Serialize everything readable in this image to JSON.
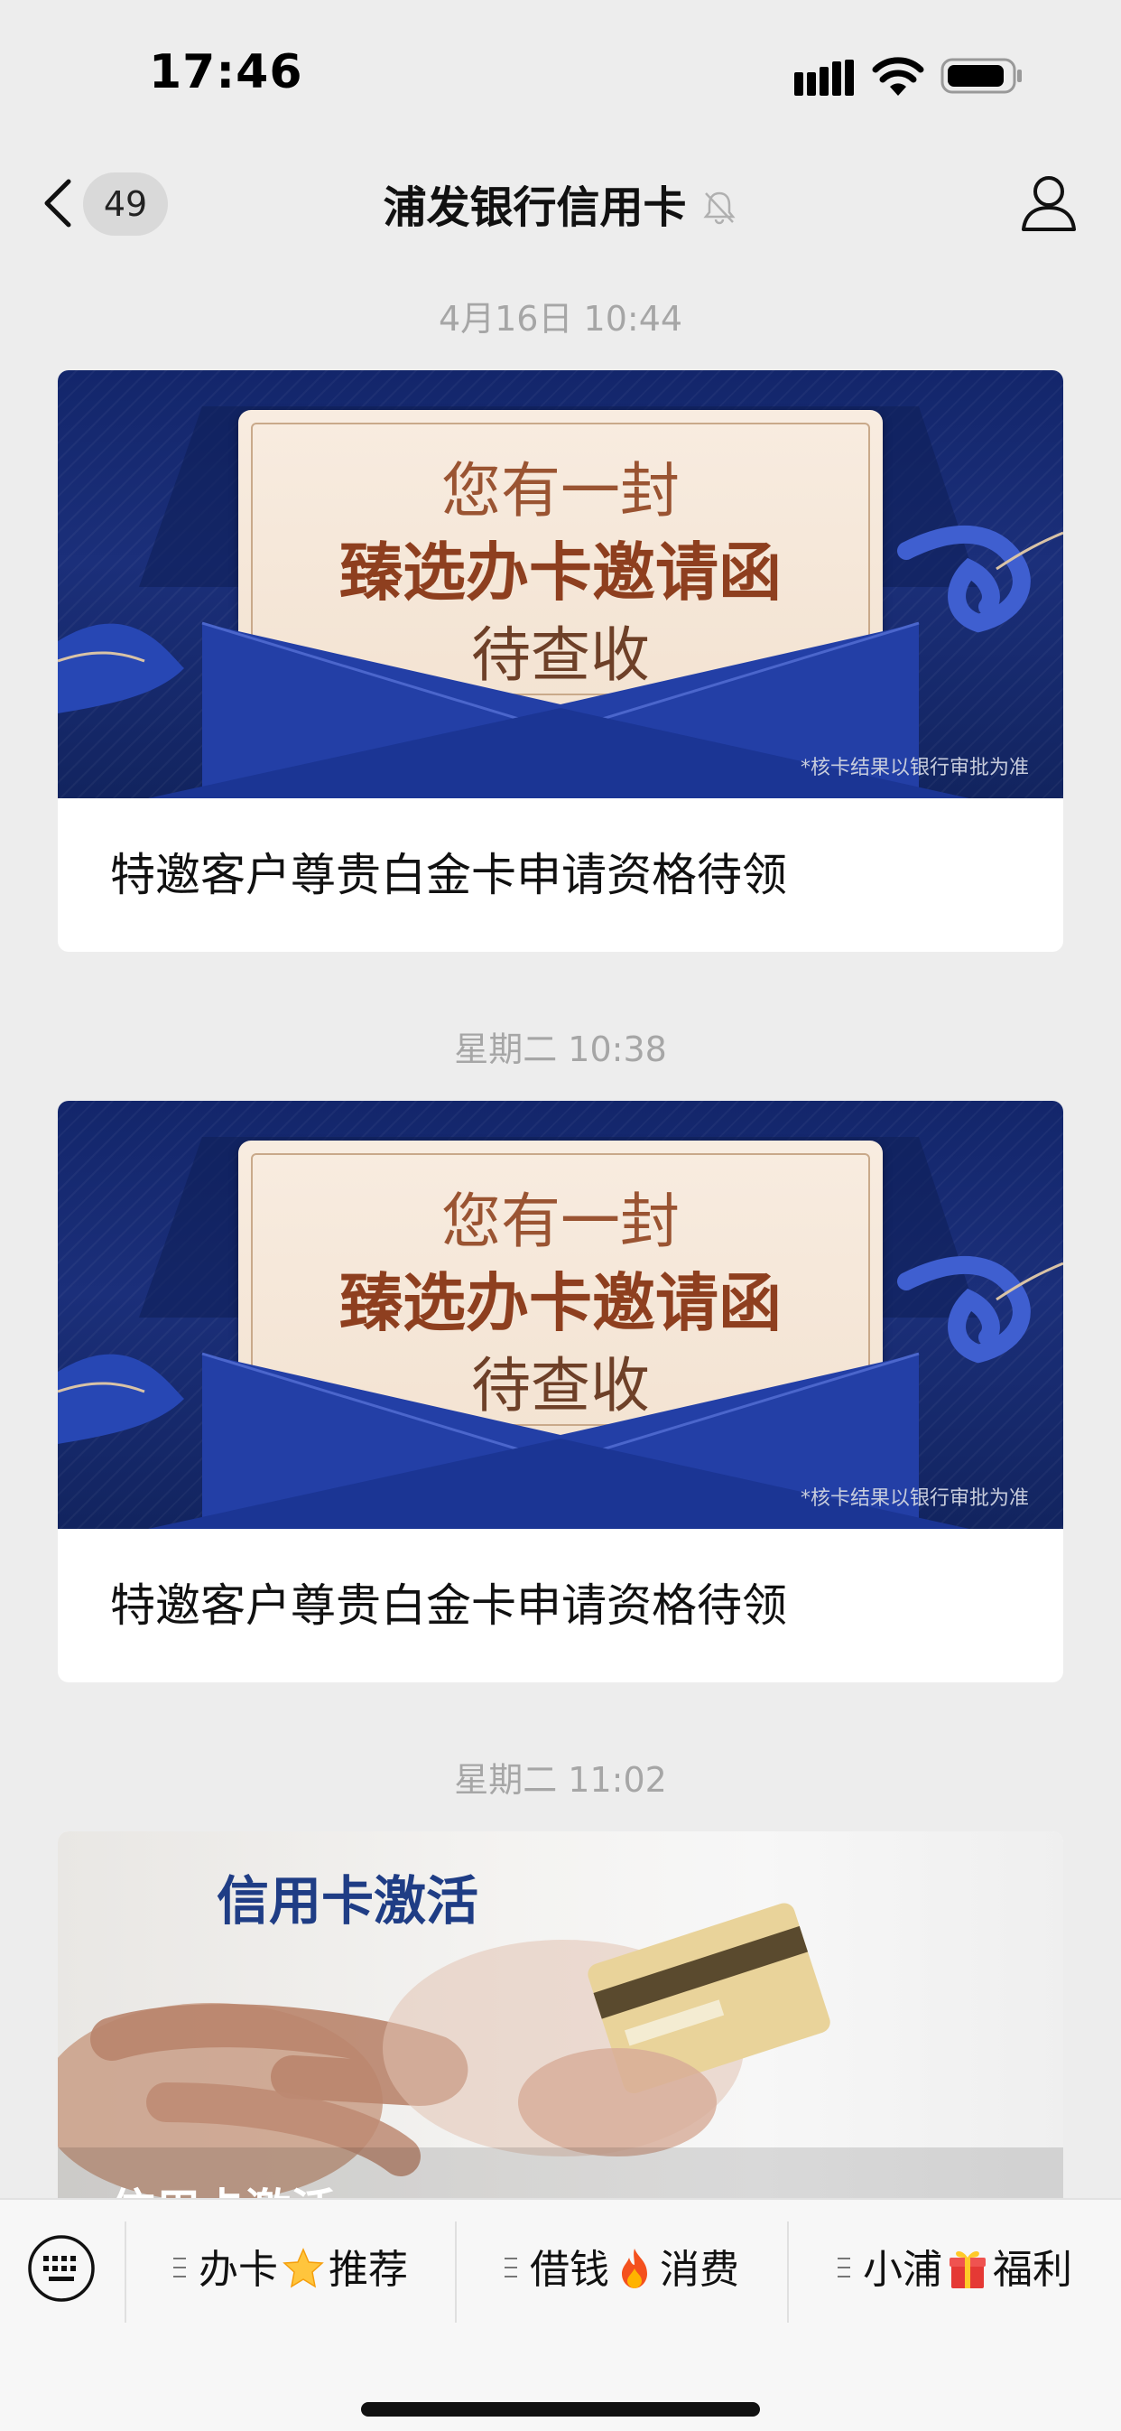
{
  "status_bar": {
    "time": "17:46"
  },
  "nav": {
    "unread_count": "49",
    "title": "浦发银行信用卡"
  },
  "messages": [
    {
      "timestamp": "4月16日 10:44",
      "invite_line1": "您有一封",
      "invite_line2": "臻选办卡邀请函",
      "invite_line3": "待查收",
      "disclaimer": "*核卡结果以银行审批为准",
      "caption": "特邀客户尊贵白金卡申请资格待领"
    },
    {
      "timestamp": "星期二 10:38",
      "invite_line1": "您有一封",
      "invite_line2": "臻选办卡邀请函",
      "invite_line3": "待查收",
      "disclaimer": "*核卡结果以银行审批为准",
      "caption": "特邀客户尊贵白金卡申请资格待领"
    },
    {
      "timestamp": "星期二 11:02",
      "image_title": "信用卡激活",
      "caption": "信用卡激活"
    }
  ],
  "bottom_menu": {
    "items": [
      {
        "label_a": "办卡",
        "emoji": "star-icon",
        "label_b": "推荐"
      },
      {
        "label_a": "借钱",
        "emoji": "fire-icon",
        "label_b": "消费"
      },
      {
        "label_a": "小浦",
        "emoji": "gift-icon",
        "label_b": "福利"
      }
    ]
  },
  "colors": {
    "background": "#ededed",
    "invite_navy": "#13266b",
    "invite_text": "#8e3f1f",
    "activation_title": "#1f3d85"
  }
}
